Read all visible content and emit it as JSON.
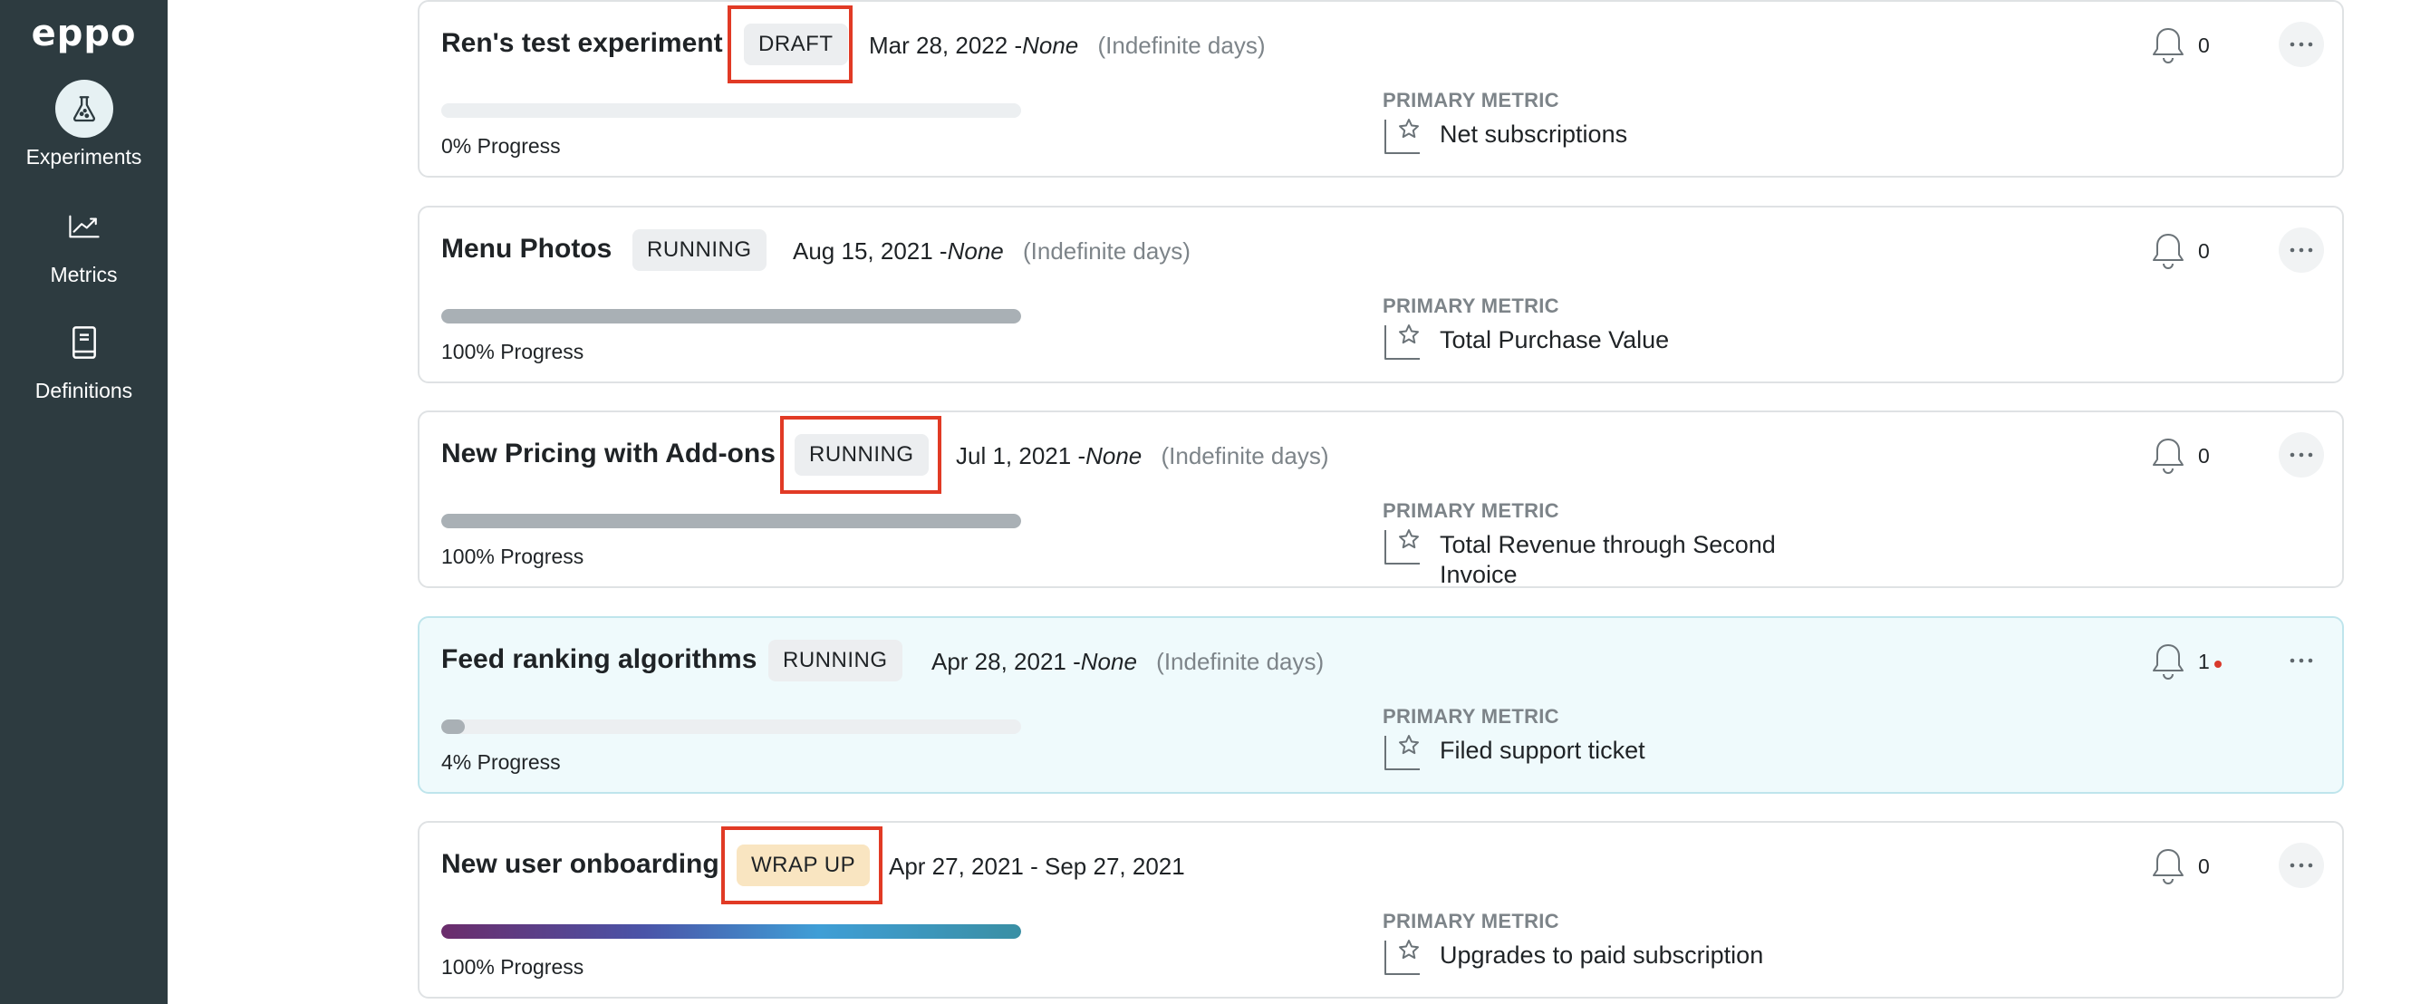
{
  "sidebar": {
    "logo": "eppo",
    "items": [
      {
        "label": "Experiments",
        "icon": "flask-icon",
        "active": true
      },
      {
        "label": "Metrics",
        "icon": "trend-chart-icon",
        "active": false
      },
      {
        "label": "Definitions",
        "icon": "book-icon",
        "active": false
      }
    ]
  },
  "experiments": [
    {
      "title": "Ren's test experiment",
      "status": "DRAFT",
      "start_date": "Mar 28, 2022",
      "end_date": "None",
      "duration": "(Indefinite days)",
      "progress_percent": 0,
      "progress_label": "0% Progress",
      "primary_metric_label": "PRIMARY METRIC",
      "primary_metric": "Net subscriptions",
      "alert_count": "0",
      "alert_unread": false
    },
    {
      "title": "Menu Photos",
      "status": "RUNNING",
      "start_date": "Aug 15, 2021",
      "end_date": "None",
      "duration": "(Indefinite days)",
      "progress_percent": 100,
      "progress_label": "100% Progress",
      "primary_metric_label": "PRIMARY METRIC",
      "primary_metric": "Total Purchase Value",
      "alert_count": "0",
      "alert_unread": false
    },
    {
      "title": "New Pricing with Add-ons",
      "status": "RUNNING",
      "start_date": "Jul 1, 2021",
      "end_date": "None",
      "duration": "(Indefinite days)",
      "progress_percent": 100,
      "progress_label": "100% Progress",
      "primary_metric_label": "PRIMARY METRIC",
      "primary_metric": "Total Revenue through Second Invoice",
      "alert_count": "0",
      "alert_unread": false
    },
    {
      "title": "Feed ranking algorithms",
      "status": "RUNNING",
      "start_date": "Apr 28, 2021",
      "end_date": "None",
      "duration": "(Indefinite days)",
      "progress_percent": 4,
      "progress_label": "4% Progress",
      "primary_metric_label": "PRIMARY METRIC",
      "primary_metric": "Filed support ticket",
      "alert_count": "1",
      "alert_unread": true
    },
    {
      "title": "New user onboarding",
      "status": "WRAP UP",
      "start_date": "Apr 27, 2021",
      "end_date": "Sep 27, 2021",
      "duration": "",
      "progress_percent": 100,
      "progress_label": "100% Progress",
      "primary_metric_label": "PRIMARY METRIC",
      "primary_metric": "Upgrades to paid subscription",
      "alert_count": "0",
      "alert_unread": false
    }
  ],
  "colors": {
    "sidebar_bg": "#2d3b40",
    "highlight_box": "#e13a25",
    "wrap_up_badge": "#f9e5c1",
    "alert_dot": "#d8392b"
  }
}
